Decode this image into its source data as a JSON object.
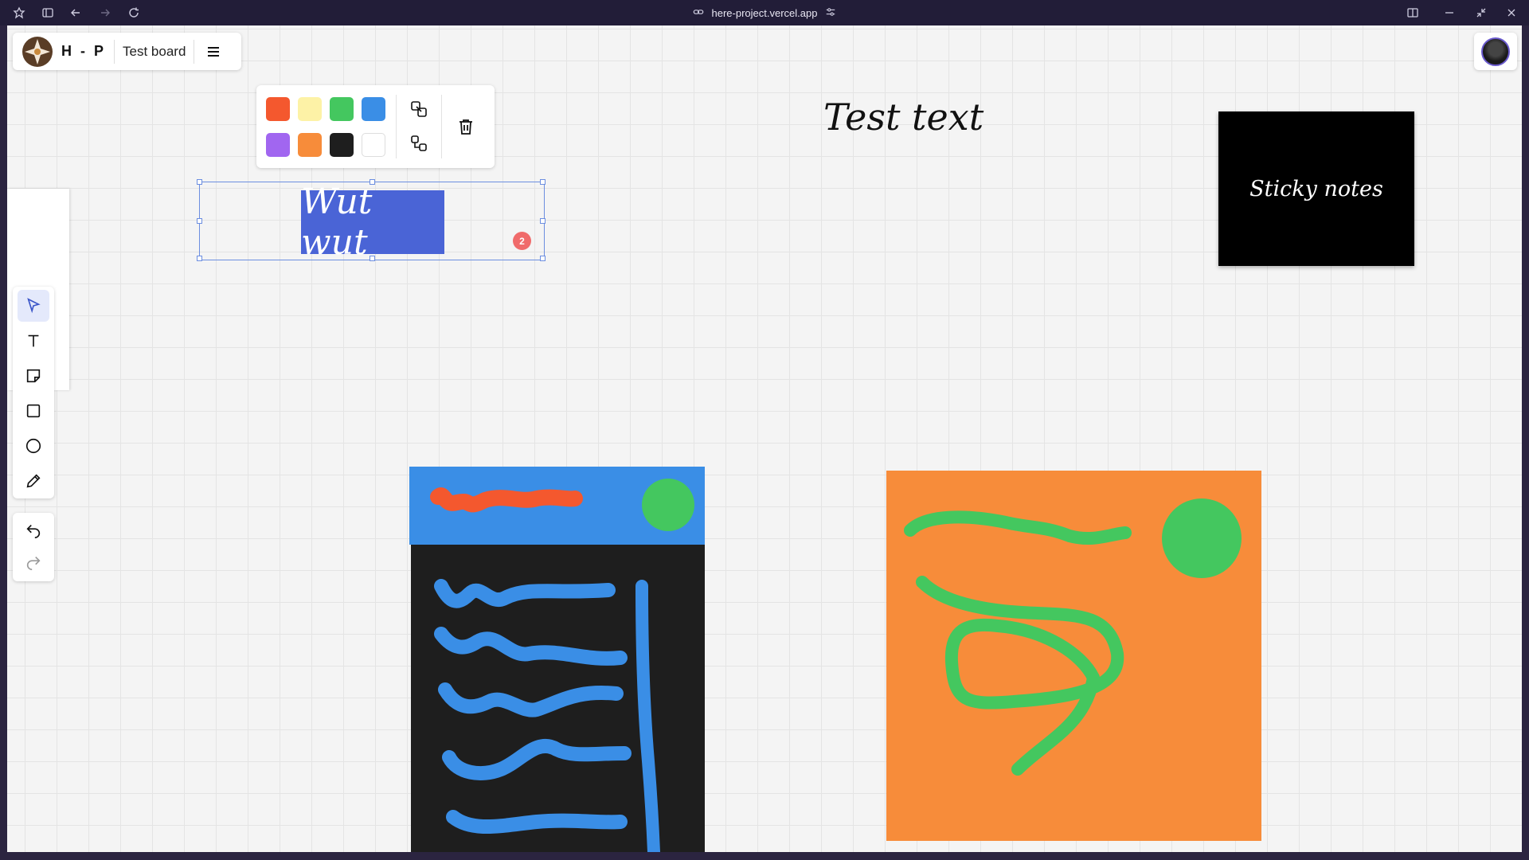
{
  "browser": {
    "url": "here-project.vercel.app"
  },
  "header": {
    "brand_name": "H - P",
    "board_name": "Test board"
  },
  "palette": {
    "colors": [
      "#f4582e",
      "#fdf2a6",
      "#44c75f",
      "#3a8ee6",
      "#a166f0",
      "#f78c3a",
      "#1e1e1e",
      "#ffffff"
    ]
  },
  "canvas": {
    "selected_text": "Wut wut",
    "selection_badge": "2",
    "text_element": "Test text",
    "sticky_note": "Sticky notes"
  },
  "tools": [
    "select-tool",
    "text-tool",
    "sticky-note-tool",
    "rectangle-tool",
    "ellipse-tool",
    "pencil-tool"
  ],
  "active_tool": "select-tool",
  "colors": {
    "selection_accent": "#4a64d6",
    "canvas_bg": "#f4f4f4",
    "titlebar_bg": "#221d38"
  }
}
